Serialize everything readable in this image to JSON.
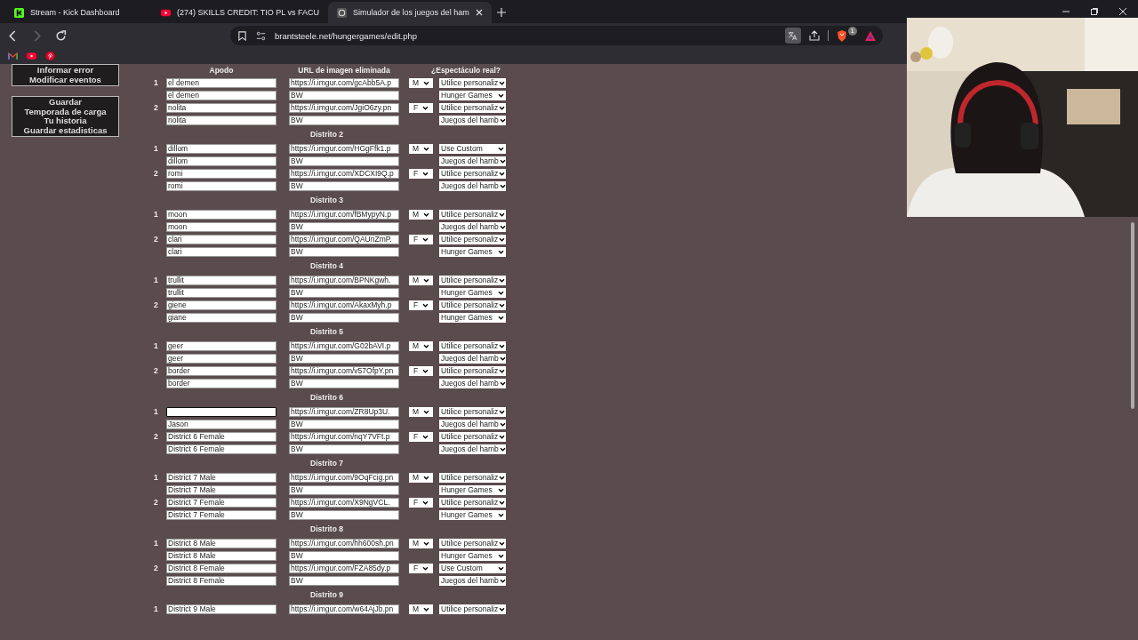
{
  "browser": {
    "tabs": [
      {
        "title": "Stream - Kick Dashboard",
        "kind": "kick",
        "selected": false
      },
      {
        "title": "(274) SKILLS CREDIT: TIO PL vs FACU",
        "kind": "youtube",
        "selected": false
      },
      {
        "title": "Simulador de los juegos del ham",
        "kind": "site",
        "selected": true
      }
    ],
    "address": "brantsteele.net/hungergames/edit.php",
    "shield_badge": "1",
    "bookmarks": [
      {
        "kind": "gmail"
      },
      {
        "kind": "youtube"
      },
      {
        "kind": "pinterest"
      }
    ]
  },
  "sidebar": {
    "menus": [
      {
        "items": [
          "Informar error",
          "Modificar eventos"
        ]
      },
      {
        "items": [
          "Guardar",
          "Temporada de carga",
          "Tu historia",
          "Guardar estadisticas"
        ]
      }
    ]
  },
  "table": {
    "columns": [
      "Apodo",
      "URL de imagen eliminada",
      "¿Espectáculo real?"
    ]
  },
  "districts": [
    {
      "tributes": [
        {
          "number": "1",
          "name": "el demen",
          "url": "https://i.imgur.com/gcAbb5A.p",
          "gender": "M",
          "show": "Utilice personaliz",
          "nickname": "el demen",
          "bw_url": "BW",
          "bw_show": "Hunger Games"
        },
        {
          "number": "2",
          "name": "nolita",
          "url": "https://i.imgur.com/JgiO6zy.pn",
          "gender": "F",
          "show": "Utilice personaliz",
          "nickname": "nolita",
          "bw_url": "BW",
          "bw_show": "Juegos del hamb"
        }
      ]
    },
    {
      "title": "Distrito 2",
      "tributes": [
        {
          "number": "1",
          "name": "dillom",
          "url": "https://i.imgur.com/HGgFfk1.p",
          "gender": "M",
          "show": "Use Custom",
          "nickname": "dillom",
          "bw_url": "BW",
          "bw_show": "Juegos del hamb"
        },
        {
          "number": "2",
          "name": "romi",
          "url": "https://i.imgur.com/XDCXI9Q.p",
          "gender": "F",
          "show": "Utilice personaliz",
          "nickname": "romi",
          "bw_url": "BW",
          "bw_show": "Juegos del hamb"
        }
      ]
    },
    {
      "title": "Distrito 3",
      "tributes": [
        {
          "number": "1",
          "name": "moon",
          "url": "https://i.imgur.com/fBMypyN.p",
          "gender": "M",
          "show": "Utilice personaliz",
          "nickname": "moon",
          "bw_url": "BW",
          "bw_show": "Juegos del hamb"
        },
        {
          "number": "2",
          "name": "clari",
          "url": "https://i.imgur.com/QAUnZmP.",
          "gender": "F",
          "show": "Utilice personaliz",
          "nickname": "clari",
          "bw_url": "BW",
          "bw_show": "Hunger Games"
        }
      ]
    },
    {
      "title": "Distrito 4",
      "tributes": [
        {
          "number": "1",
          "name": "trullit",
          "url": "https://i.imgur.com/BPNKgwh.",
          "gender": "M",
          "show": "Utilice personaliz",
          "nickname": "trullit",
          "bw_url": "BW",
          "bw_show": "Hunger Games"
        },
        {
          "number": "2",
          "name": "giene",
          "url": "https://i.imgur.com/AkaxMyh.p",
          "gender": "F",
          "show": "Utilice personaliz",
          "nickname": "giane",
          "bw_url": "BW",
          "bw_show": "Hunger Games"
        }
      ]
    },
    {
      "title": "Distrito 5",
      "tributes": [
        {
          "number": "1",
          "name": "geer",
          "url": "https://i.imgur.com/G02bAVI.p",
          "gender": "M",
          "show": "Utilice personaliz",
          "nickname": "geer",
          "bw_url": "BW",
          "bw_show": "Juegos del hamb"
        },
        {
          "number": "2",
          "name": "border",
          "url": "https://i.imgur.com/v57OfpY.pn",
          "gender": "F",
          "show": "Utilice personaliz",
          "nickname": "border",
          "bw_url": "BW",
          "bw_show": "Juegos del hamb"
        }
      ]
    },
    {
      "title": "Distrito 6",
      "tributes": [
        {
          "number": "1",
          "focused": true,
          "url": "https://i.imgur.com/ZR8Up3U.",
          "gender": "M",
          "show": "Utilice personaliz",
          "nickname": "Jason",
          "bw_url": "BW",
          "bw_show": "Juegos del hamb"
        },
        {
          "number": "2",
          "focused": false,
          "name": "District 6 Female",
          "url": "https://i.imgur.com/nqY7VFt.p",
          "gender": "F",
          "show": "Utilice personaliz",
          "nickname": "District 6 Female",
          "bw_url": "BW",
          "bw_show": "Juegos del hamb"
        }
      ]
    },
    {
      "title": "Distrito 7",
      "tributes": [
        {
          "number": "1",
          "name": "District 7 Male",
          "url": "https://i.imgur.com/9OqFcig.pn",
          "gender": "M",
          "show": "Utilice personaliz",
          "nickname": "District 7 Male",
          "bw_url": "BW",
          "bw_show": "Hunger Games"
        },
        {
          "number": "2",
          "name": "District 7 Female",
          "url": "https://i.imgur.com/X9NgVCL.",
          "gender": "F",
          "show": "Utilice personaliz",
          "nickname": "District 7 Female",
          "bw_url": "BW",
          "bw_show": "Hunger Games"
        }
      ]
    },
    {
      "title": "Distrito 8",
      "tributes": [
        {
          "number": "1",
          "name": "District 8 Male",
          "url": "https://i.imgur.com/hh600sh.pn",
          "gender": "M",
          "show": "Utilice personaliz",
          "nickname": "District 8 Male",
          "bw_url": "BW",
          "bw_show": "Hunger Games"
        },
        {
          "number": "2",
          "name": "District 8 Female",
          "url": "https://i.imgur.com/FZA85dy.p",
          "gender": "F",
          "show": "Use Custom",
          "nickname": "District 8 Female",
          "bw_url": "BW",
          "bw_show": "Juegos del hamb"
        }
      ]
    },
    {
      "title": "Distrito 9",
      "tributes": [
        {
          "number": "1",
          "name": "District 9 Male",
          "url": "https://i.imgur.com/w64AjJb.pn",
          "gender": "M",
          "show": "Utilice personaliz"
        }
      ]
    }
  ]
}
